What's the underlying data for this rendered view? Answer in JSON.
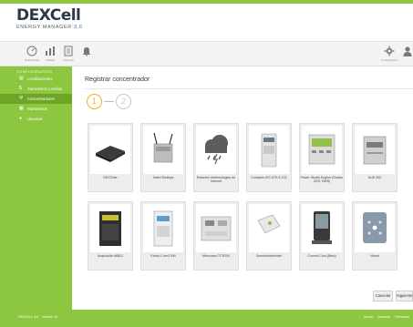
{
  "app": {
    "logo_main": "DEXCell",
    "logo_sub": "ENERGY MANAGER 3.0"
  },
  "colors": {
    "brand_green": "#8dc63f",
    "active_green": "#6ea526",
    "step_active": "#f5b018",
    "step_inactive": "#c9c9c9"
  },
  "toolbar": {
    "left_buttons": [
      {
        "icon": "gauge-icon",
        "caption": "Dashboards"
      },
      {
        "icon": "chart-icon",
        "caption": "Analisis"
      },
      {
        "icon": "report-icon",
        "caption": "Informes"
      },
      {
        "icon": "bell-icon",
        "caption": ""
      }
    ],
    "right_buttons": [
      {
        "icon": "gear-icon",
        "caption": "Configuración"
      },
      {
        "icon": "user-icon",
        "caption": ""
      }
    ]
  },
  "sidebar": {
    "heading": "CONFIGURACIÓN",
    "items": [
      {
        "label": "Localizaciones",
        "icon": "building-icon",
        "active": false
      },
      {
        "label": "Suministros y tarifas",
        "icon": "dollar-icon",
        "active": false
      },
      {
        "label": "Concentradores",
        "icon": "antenna-icon",
        "active": true
      },
      {
        "label": "Parámetros",
        "icon": "grid-icon",
        "active": false
      },
      {
        "label": "Usuarios",
        "icon": "person-icon",
        "active": false
      }
    ]
  },
  "main": {
    "title": "Registrar concentrador",
    "steps": [
      "1",
      "2"
    ],
    "devices": [
      {
        "label": "DEXGate",
        "icon": "gateway-device-icon"
      },
      {
        "label": "Sakel Dealsys",
        "icon": "router-device-icon"
      },
      {
        "label": "Estación meteorológica de Internet",
        "icon": "weather-cloud-icon"
      },
      {
        "label": "Contador IEC 870-5-102",
        "icon": "electric-meter-icon"
      },
      {
        "label": "Power Studio Engine (Scada, CES, BMS)",
        "icon": "power-analyzer-icon"
      },
      {
        "label": "DUE 300",
        "icon": "din-module-icon"
      },
      {
        "label": "Acquisuite A8812",
        "icon": "acquisuite-device-icon"
      },
      {
        "label": "Etnico Com2 RM",
        "icon": "din-meter-icon"
      },
      {
        "label": "Mercuram TCR200",
        "icon": "din-controller-icon"
      },
      {
        "label": "Sensorsinkrender",
        "icon": "wall-sensor-icon"
      },
      {
        "label": "Current Cost (Beta)",
        "icon": "display-monitor-icon"
      },
      {
        "label": "Virtual",
        "icon": "virtual-device-icon"
      }
    ],
    "buttons": {
      "cancel": "Cancelar",
      "next": "Siguiente"
    }
  },
  "footer": {
    "left": "DEXCELL 3.0",
    "left2": "Versión 10",
    "links": [
      "Ayuda",
      "Contacto",
      "Feedback"
    ]
  }
}
